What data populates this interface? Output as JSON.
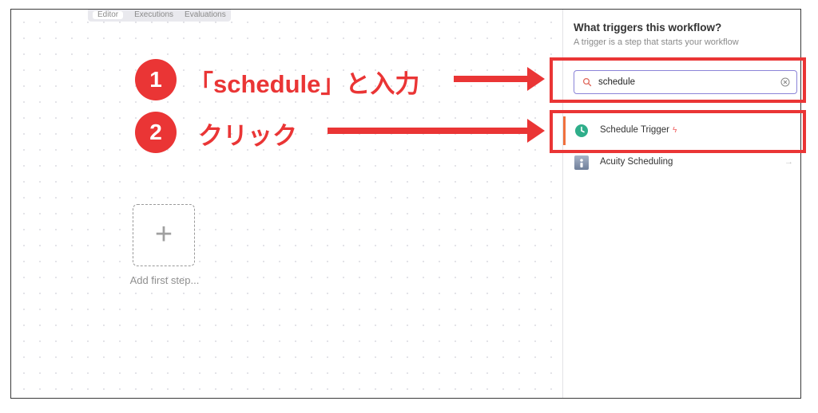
{
  "editor": {
    "tabs": [
      {
        "label": "Editor",
        "active": true
      },
      {
        "label": "Executions",
        "active": false
      },
      {
        "label": "Evaluations",
        "active": false
      }
    ],
    "add_first_step_label": "Add first step..."
  },
  "panel": {
    "title": "What triggers this workflow?",
    "subtitle": "A trigger is a step that starts your workflow",
    "search": {
      "value": "schedule",
      "icon": "search-icon",
      "clear_icon": "clear-circle-icon"
    },
    "results": [
      {
        "label": "Schedule Trigger",
        "icon": "clock-icon",
        "badge_icon": "bolt-icon",
        "selected": true
      },
      {
        "label": "Acuity Scheduling",
        "icon": "acuity-logo-icon",
        "trailing_icon": "arrow-right-icon",
        "selected": false
      }
    ]
  },
  "annotations": [
    {
      "number": "1",
      "text": "「schedule」と入力"
    },
    {
      "number": "2",
      "text": "クリック"
    }
  ],
  "colors": {
    "annotation_red": "#ea3535",
    "selected_accent": "#f0703d",
    "search_border": "#8b84d8",
    "clock_green": "#2fae8a"
  }
}
